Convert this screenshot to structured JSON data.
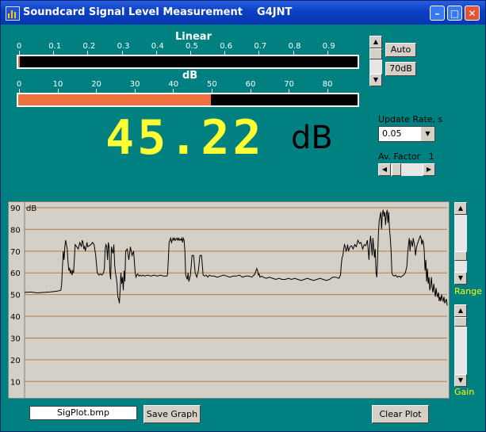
{
  "window": {
    "title": "Soundcard Signal Level Measurement    G4JNT"
  },
  "linear_scale": {
    "label": "Linear",
    "ticks": [
      "0",
      "0.1",
      "0.2",
      "0.3",
      "0.4",
      "0.5",
      "0.6",
      "0.7",
      "0.8",
      "0.9"
    ],
    "level": 0.005
  },
  "db_scale": {
    "label": "dB",
    "ticks": [
      "0",
      "10",
      "20",
      "30",
      "40",
      "50",
      "60",
      "70",
      "80"
    ],
    "level_db": 50.6,
    "max_db": 89
  },
  "reading": {
    "value": "45.22",
    "unit": "dB"
  },
  "buttons": {
    "auto": "Auto",
    "range_70": "70dB",
    "save_graph": "Save Graph",
    "clear_plot": "Clear Plot"
  },
  "update_rate": {
    "label": "Update Rate, s",
    "value": "0.05"
  },
  "av_factor": {
    "label": "Av. Factor",
    "value": "1"
  },
  "side_labels": {
    "range": "Range",
    "gain": "Gain"
  },
  "file": {
    "name": "SigPlot.bmp"
  },
  "colors": {
    "background": "#008080",
    "reading": "#ffff33",
    "meter_fill": "#f07040",
    "gridline": "#b08040",
    "label_yellow": "#ffff00"
  },
  "chart_data": {
    "type": "line",
    "ylabel": "dB",
    "ylim": [
      5,
      90
    ],
    "yticks": [
      "90",
      "80",
      "70",
      "60",
      "50",
      "40",
      "30",
      "20",
      "10"
    ],
    "grid": true,
    "x": [
      0,
      8,
      16,
      24,
      32,
      40,
      46,
      47,
      48,
      49,
      50,
      51,
      52,
      53,
      54,
      55,
      56,
      57,
      58,
      59,
      60,
      61,
      62,
      64,
      66,
      68,
      70,
      72,
      73,
      74,
      75,
      76,
      77,
      78,
      79,
      80,
      84,
      86,
      88,
      90,
      92,
      94,
      96,
      98,
      100,
      101,
      102,
      103,
      104,
      105,
      106,
      107,
      108,
      109,
      110,
      111,
      112,
      113,
      114,
      115,
      116,
      117,
      118,
      119,
      120,
      121,
      122,
      123,
      124,
      125,
      126,
      127,
      128,
      130,
      132,
      134,
      136,
      138,
      140,
      141,
      142,
      143,
      144,
      145,
      146,
      148,
      150,
      152,
      156,
      160,
      164,
      168,
      172,
      176,
      180,
      181,
      182,
      183,
      184,
      185,
      186,
      187,
      188,
      189,
      190,
      191,
      192,
      193,
      194,
      195,
      196,
      197,
      198,
      199,
      200,
      201,
      202,
      203,
      204,
      205,
      206,
      207,
      208,
      210,
      212,
      214,
      216,
      218,
      220,
      222,
      224,
      226,
      228,
      230,
      232,
      234,
      236,
      240,
      244,
      248,
      252,
      256,
      260,
      264,
      268,
      272,
      276,
      280,
      284,
      288,
      290,
      291,
      292,
      293,
      294,
      295,
      296,
      297,
      298,
      300,
      302,
      306,
      310,
      314,
      318,
      322,
      326,
      330,
      334,
      338,
      342,
      346,
      350,
      354,
      358,
      362,
      366,
      370,
      374,
      378,
      382,
      386,
      390,
      394,
      398,
      400,
      401,
      402,
      403,
      404,
      405,
      406,
      407,
      408,
      409,
      410,
      412,
      414,
      416,
      418,
      420,
      422,
      424,
      426,
      428,
      430,
      432,
      434,
      436,
      437,
      438,
      439,
      440,
      441,
      442,
      443,
      444,
      445,
      446,
      447,
      448,
      449,
      450,
      451,
      452,
      453,
      454,
      455,
      456,
      457,
      458,
      459,
      460,
      461,
      462,
      463,
      464,
      465,
      466,
      468,
      470,
      472,
      474,
      476,
      478,
      480,
      482,
      484,
      485,
      486,
      487,
      488,
      489,
      490,
      491,
      492,
      493,
      494,
      495,
      496,
      497,
      498,
      499,
      500,
      501,
      502,
      503,
      504,
      505,
      506,
      507,
      508,
      509,
      510,
      511,
      512,
      513,
      514,
      515,
      516,
      517,
      518,
      519,
      520,
      521,
      522,
      523,
      524,
      525,
      526,
      527,
      528,
      529,
      530,
      531,
      532,
      533,
      534,
      535
    ],
    "y": [
      51.0,
      51.2,
      50.8,
      51.0,
      51.2,
      51.5,
      52.0,
      55.0,
      63.0,
      70.0,
      66.0,
      72.0,
      75.0,
      73.0,
      71.0,
      65.0,
      61.0,
      62.0,
      60.0,
      61.0,
      59.0,
      61.0,
      60.0,
      73.0,
      72.0,
      71.0,
      74.0,
      72.0,
      75.0,
      74.0,
      71.0,
      72.0,
      70.0,
      72.0,
      74.0,
      72.0,
      73.0,
      74.0,
      73.0,
      68.0,
      60.0,
      59.0,
      59.5,
      59.0,
      60.0,
      62.0,
      71.0,
      73.0,
      72.0,
      66.0,
      74.0,
      72.0,
      60.0,
      57.0,
      72.0,
      70.0,
      69.0,
      73.0,
      64.0,
      60.0,
      58.0,
      55.0,
      49.0,
      48.0,
      46.0,
      52.0,
      60.0,
      55.0,
      58.0,
      52.0,
      61.0,
      56.0,
      70.0,
      71.0,
      66.0,
      72.0,
      68.0,
      70.0,
      60.0,
      58.0,
      59.0,
      59.5,
      59.0,
      58.5,
      59.0,
      58.5,
      59.0,
      58.5,
      59.0,
      58.5,
      59.0,
      58.5,
      59.0,
      58.5,
      58.5,
      59.0,
      66.0,
      74.0,
      75.0,
      76.0,
      74.0,
      75.0,
      76.0,
      75.0,
      76.0,
      75.0,
      75.5,
      76.0,
      75.0,
      76.0,
      75.0,
      75.5,
      75.0,
      76.0,
      74.0,
      76.0,
      75.0,
      70.0,
      59.0,
      58.0,
      57.0,
      60.0,
      56.0,
      59.0,
      68.0,
      68.0,
      60.0,
      58.0,
      61.0,
      68.0,
      68.0,
      59.0,
      58.5,
      59.0,
      58.0,
      59.0,
      58.5,
      58.5,
      58.0,
      58.5,
      59.0,
      58.5,
      58.0,
      58.5,
      58.5,
      59.0,
      58.0,
      58.5,
      58.5,
      58.0,
      59.0,
      59.0,
      60.0,
      61.0,
      62.0,
      61.0,
      59.0,
      59.5,
      58.0,
      58.5,
      58.0,
      57.5,
      58.0,
      57.5,
      57.0,
      57.5,
      57.0,
      57.0,
      57.5,
      57.0,
      57.5,
      57.0,
      56.5,
      57.0,
      57.5,
      57.0,
      56.5,
      57.0,
      57.5,
      57.0,
      56.5,
      57.0,
      58.0,
      58.0,
      57.5,
      59.0,
      64.0,
      67.0,
      68.0,
      71.0,
      73.0,
      72.0,
      70.0,
      71.0,
      73.0,
      70.0,
      72.0,
      72.5,
      71.0,
      73.0,
      72.0,
      75.0,
      73.5,
      74.0,
      71.0,
      73.0,
      72.5,
      75.0,
      66.0,
      73.0,
      77.0,
      73.0,
      68.0,
      76.0,
      72.0,
      67.0,
      71.0,
      60.0,
      58.0,
      67.0,
      78.0,
      84.0,
      86.0,
      88.0,
      80.0,
      87.0,
      89.0,
      86.0,
      88.0,
      82.0,
      87.0,
      89.0,
      83.0,
      88.0,
      80.0,
      76.0,
      70.0,
      60.0,
      59.0,
      58.5,
      59.0,
      58.0,
      58.5,
      58.0,
      58.5,
      59.0,
      60.0,
      63.0,
      69.0,
      73.0,
      76.0,
      70.0,
      75.0,
      74.0,
      72.0,
      76.0,
      74.0,
      72.0,
      68.0,
      71.0,
      73.0,
      74.0,
      75.0,
      76.0,
      77.0,
      76.0,
      73.0,
      75.0,
      74.0,
      70.0,
      61.0,
      66.0,
      56.0,
      62.0,
      55.0,
      58.0,
      52.0,
      54.0,
      58.0,
      53.0,
      51.0,
      55.0,
      52.0,
      49.0,
      53.0,
      50.0,
      49.0,
      51.0,
      47.0,
      49.0,
      47.0,
      50.0,
      48.0,
      47.0,
      49.0,
      46.0,
      47.0,
      48.0,
      45.0,
      46.0,
      45.0
    ]
  }
}
